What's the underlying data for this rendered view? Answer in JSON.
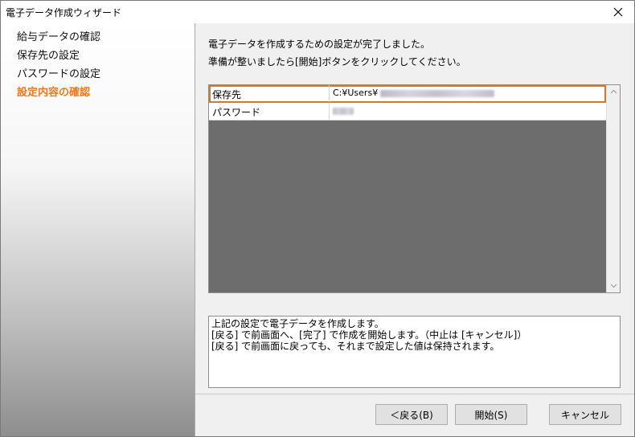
{
  "window": {
    "title": "電子データ作成ウィザード"
  },
  "steps": [
    {
      "label": "給与データの確認",
      "active": false
    },
    {
      "label": "保存先の設定",
      "active": false
    },
    {
      "label": "パスワードの設定",
      "active": false
    },
    {
      "label": "設定内容の確認",
      "active": true
    }
  ],
  "message": {
    "line1": "電子データを作成するための設定が完了しました。",
    "line2": "準備が整いましたら[開始]ボタンをクリックしてください。"
  },
  "settings_table": {
    "rows": [
      {
        "label": "保存先",
        "value": "C:¥Users¥",
        "selected": true
      },
      {
        "label": "パスワード",
        "value": "",
        "selected": false
      }
    ]
  },
  "description": {
    "lines": [
      "上記の設定で電子データを作成します。",
      "[戻る] で前画面へ、[完了] で作成を開始します。（中止は [キャンセル]）",
      "[戻る] で前画面に戻っても、それまで設定した値は保持されます。"
    ]
  },
  "buttons": {
    "back": "＜戻る(B)",
    "start": "開始(S)",
    "cancel": "キャンセル"
  },
  "icons": {
    "close": "close-icon",
    "scroll_up": "chevron-up-icon",
    "scroll_down": "chevron-down-icon"
  },
  "colors": {
    "active_step": "#ee7a1c",
    "selected_row_border": "#d07a2f",
    "grid_empty": "#6d6d6d"
  }
}
